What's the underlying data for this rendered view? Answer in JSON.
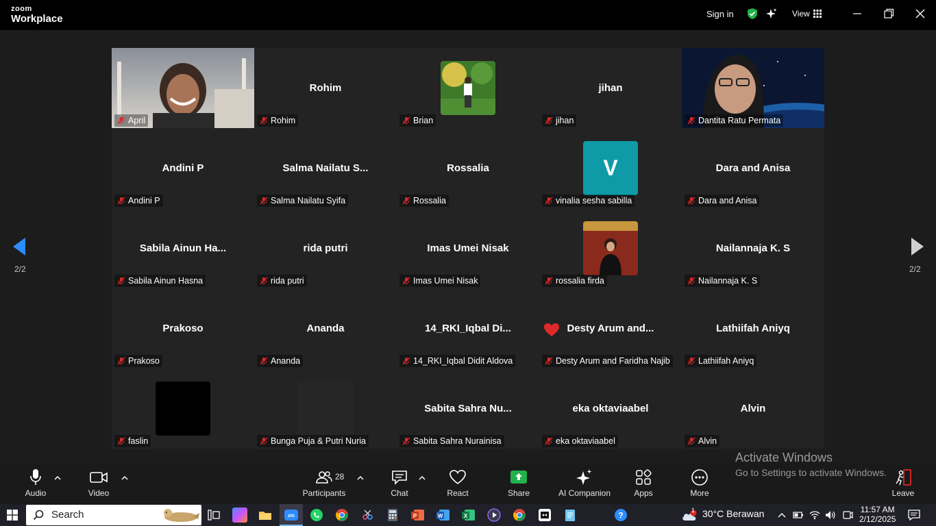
{
  "app": {
    "brand_top": "zoom",
    "brand_bottom": "Workplace",
    "sign_in": "Sign in",
    "view": "View"
  },
  "nav": {
    "page_indicator": "2/2"
  },
  "participants": [
    {
      "tile": "",
      "label": "April",
      "kind": "video"
    },
    {
      "tile": "Rohim",
      "label": "Rohim",
      "kind": "name"
    },
    {
      "tile": "",
      "label": "Brian",
      "kind": "photo"
    },
    {
      "tile": "jihan",
      "label": "jihan",
      "kind": "name"
    },
    {
      "tile": "",
      "label": "Dantita Ratu Permata",
      "kind": "video"
    },
    {
      "tile": "Andini P",
      "label": "Andini P",
      "kind": "name"
    },
    {
      "tile": "Salma  Nailatu  S...",
      "label": "Salma Nailatu Syifa",
      "kind": "name"
    },
    {
      "tile": "Rossalia",
      "label": "Rossalia",
      "kind": "name"
    },
    {
      "tile": "V",
      "label": "vinalia sesha sabilla",
      "kind": "initial"
    },
    {
      "tile": "Dara and Anisa",
      "label": "Dara and Anisa",
      "kind": "name"
    },
    {
      "tile": "Sabila  Ainun  Ha...",
      "label": "Sabila Ainun Hasna",
      "kind": "name"
    },
    {
      "tile": "rida putri",
      "label": "rida putri",
      "kind": "name"
    },
    {
      "tile": "Imas Umei Nisak",
      "label": "Imas Umei Nisak",
      "kind": "name"
    },
    {
      "tile": "",
      "label": "rossalia firda",
      "kind": "photo2"
    },
    {
      "tile": "Nailannaja K. S",
      "label": "Nailannaja K. S",
      "kind": "name"
    },
    {
      "tile": "Prakoso",
      "label": "Prakoso",
      "kind": "name"
    },
    {
      "tile": "Ananda",
      "label": "Ananda",
      "kind": "name"
    },
    {
      "tile": "14_RKI_Iqbal  Di...",
      "label": "14_RKI_Iqbal Didit Aldova",
      "kind": "name"
    },
    {
      "tile": "Desty Arum  and...",
      "label": "Desty Arum and Faridha Najib",
      "kind": "name"
    },
    {
      "tile": "Lathiifah Aniyq",
      "label": "Lathiifah Aniyq",
      "kind": "name"
    },
    {
      "tile": "",
      "label": "faslin",
      "kind": "black"
    },
    {
      "tile": "",
      "label": "Bunga Puja & Putri Nuria",
      "kind": "dark"
    },
    {
      "tile": "Sabita  Sahra  Nu...",
      "label": "Sabita Sahra Nurainisa",
      "kind": "name"
    },
    {
      "tile": "eka oktaviaabel",
      "label": "eka oktaviaabel",
      "kind": "name"
    },
    {
      "tile": "Alvin",
      "label": "Alvin",
      "kind": "name"
    }
  ],
  "toolbar": {
    "audio": "Audio",
    "video": "Video",
    "participants": "Participants",
    "participants_count": "28",
    "chat": "Chat",
    "react": "React",
    "share": "Share",
    "ai_companion": "AI Companion",
    "apps": "Apps",
    "more": "More",
    "leave": "Leave"
  },
  "watermark": {
    "line1": "Activate Windows",
    "line2": "Go to Settings to activate Windows."
  },
  "taskbar": {
    "search": "Search",
    "weather_badge": "1",
    "weather": "30°C  Berawan",
    "time": "11:57 AM",
    "date": "2/12/2025"
  },
  "colors": {
    "accent_green": "#22b14c",
    "avatar_teal": "#0e9aa7",
    "muted_red": "#e02828",
    "nav_blue": "#2d8cff"
  }
}
